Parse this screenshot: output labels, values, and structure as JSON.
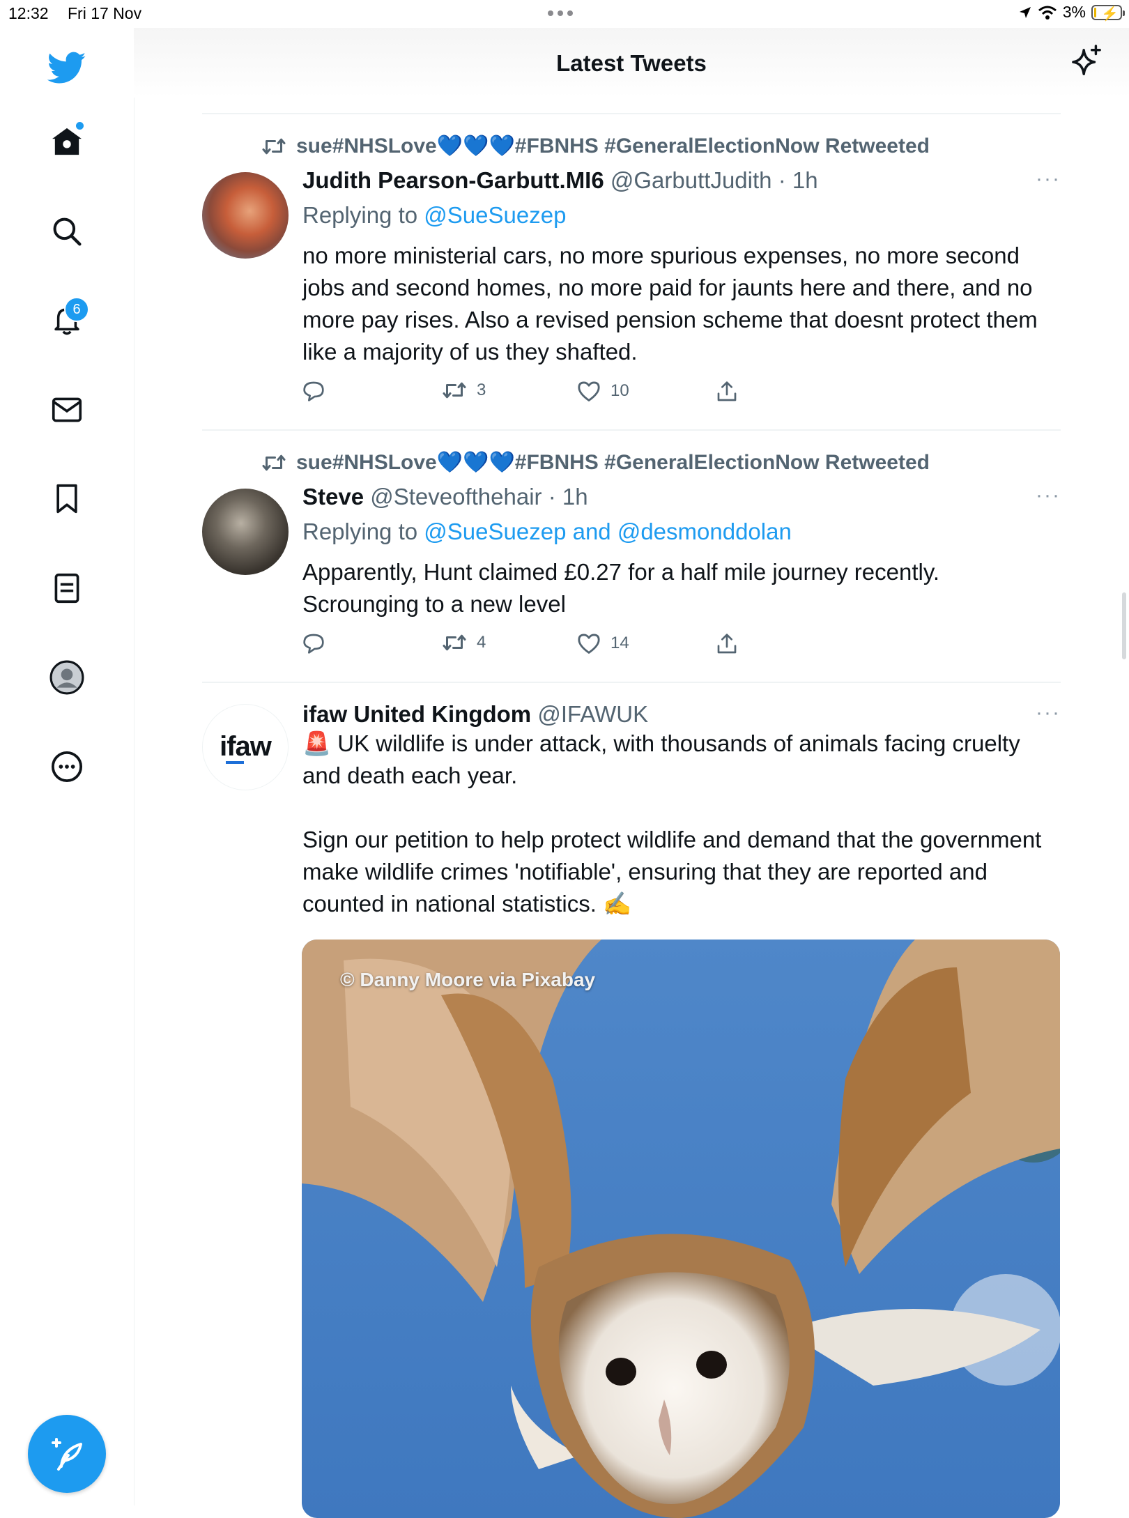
{
  "status_bar": {
    "time": "12:32",
    "date": "Fri 17 Nov",
    "battery": "3%",
    "battery_level": 0.03
  },
  "sidebar": {
    "notifications_badge": "6",
    "items": [
      "twitter-logo",
      "home",
      "search",
      "notifications",
      "messages",
      "bookmarks",
      "lists",
      "profile",
      "more"
    ]
  },
  "header": {
    "title": "Latest Tweets"
  },
  "tweets": [
    {
      "retweeted_by": "sue#NHSLove💙💙💙#FBNHS #GeneralElectionNow Retweeted",
      "name": "Judith Pearson-Garbutt.MI6",
      "handle": "@GarbuttJudith",
      "time": "· 1h",
      "replying_prefix": "Replying to",
      "replying_to": "@SueSuezep",
      "text": "no more ministerial cars, no more spurious expenses, no more second jobs and second homes, no more paid for jaunts here and there, and no more pay rises. Also a revised pension scheme that doesnt protect them like a majority of us they shafted.",
      "retweets": "3",
      "likes": "10"
    },
    {
      "retweeted_by": "sue#NHSLove💙💙💙#FBNHS #GeneralElectionNow Retweeted",
      "name": "Steve",
      "handle": "@Steveofthehair",
      "time": "· 1h",
      "replying_prefix": "Replying to",
      "replying_to": "@SueSuezep and @desmonddolan",
      "text": "Apparently, Hunt claimed £0.27 for a half mile journey recently.\nScrounging to a new level",
      "retweets": "4",
      "likes": "14"
    },
    {
      "name": "ifaw United Kingdom",
      "handle": "@IFAWUK",
      "avatar_logo": "ifaw",
      "text": "🚨 UK wildlife is under attack, with thousands of animals facing cruelty and death each year.\n\nSign our petition to help protect wildlife and demand that the government make wildlife crimes 'notifiable', ensuring that they are reported and counted in national statistics. ✍️",
      "media_credit": "© Danny Moore via Pixabay"
    }
  ],
  "colors": {
    "accent": "#1d9bf0",
    "text": "#0f1419",
    "muted": "#536471"
  }
}
